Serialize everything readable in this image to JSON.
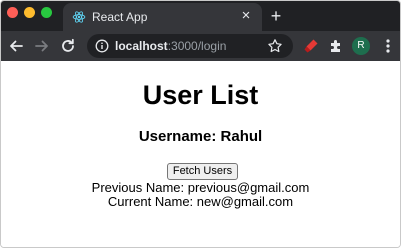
{
  "browser": {
    "tab_title": "React App",
    "tab_close": "×",
    "new_tab": "+",
    "url_host": "localhost",
    "url_path": ":3000/login",
    "profile_initial": "R",
    "icons": {
      "tab_favicon": "react-icon",
      "back": "arrow-left-icon",
      "forward": "arrow-right-icon",
      "reload": "reload-icon",
      "info": "info-icon",
      "bookmark": "star-icon",
      "extension1": "red-extension-icon",
      "extension2": "puzzle-icon",
      "menu": "kebab-menu-icon"
    },
    "colors": {
      "frame": "#202124",
      "toolbar": "#35363a",
      "avatar": "#1e6e4e"
    }
  },
  "page": {
    "title": "User List",
    "username_line": "Username: Rahul",
    "fetch_button": "Fetch Users",
    "previous_name": "Previous Name: previous@gmail.com",
    "current_name": "Current Name: new@gmail.com"
  }
}
